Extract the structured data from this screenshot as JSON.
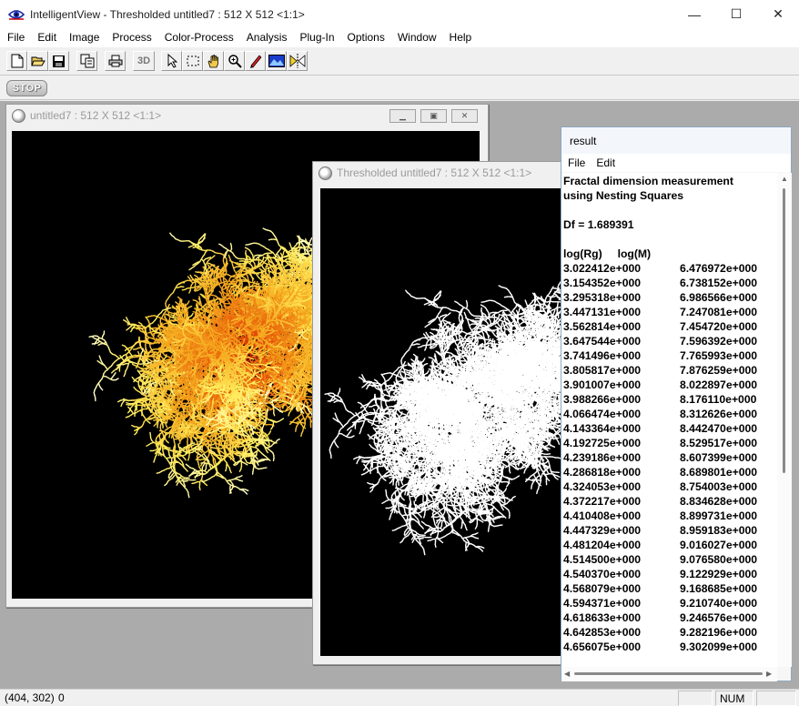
{
  "app": {
    "title": "IntelligentView - Thresholded untitled7 : 512 X 512  <1:1>"
  },
  "window_controls": {
    "minimize": "—",
    "maximize": "☐",
    "close": "✕"
  },
  "menu": [
    "File",
    "Edit",
    "Image",
    "Process",
    "Color-Process",
    "Analysis",
    "Plug-In",
    "Options",
    "Window",
    "Help"
  ],
  "toolbar": {
    "icons": [
      "new-file-icon",
      "open-folder-icon",
      "save-icon",
      "copy-icon",
      "print-icon",
      "3d-icon",
      "pointer-icon",
      "select-rect-icon",
      "hand-icon",
      "zoom-icon",
      "pen-icon",
      "image-icon",
      "flip-icon"
    ],
    "label_3d": "3D",
    "stop_label": "STOP"
  },
  "windows": {
    "original": {
      "title": "untitled7 : 512 X 512  <1:1>"
    },
    "thresholded": {
      "title": "Thresholded untitled7 : 512 X 512  <1:1>"
    }
  },
  "result": {
    "title": "result",
    "menu": [
      "File",
      "Edit"
    ],
    "heading_line1": "Fractal dimension measurement",
    "heading_line2": "using Nesting Squares",
    "df": "Df = 1.689391",
    "col_header": "log(Rg)     log(M)",
    "rows": [
      [
        "3.022412e+000",
        "6.476972e+000"
      ],
      [
        "3.154352e+000",
        "6.738152e+000"
      ],
      [
        "3.295318e+000",
        "6.986566e+000"
      ],
      [
        "3.447131e+000",
        "7.247081e+000"
      ],
      [
        "3.562814e+000",
        "7.454720e+000"
      ],
      [
        "3.647544e+000",
        "7.596392e+000"
      ],
      [
        "3.741496e+000",
        "7.765993e+000"
      ],
      [
        "3.805817e+000",
        "7.876259e+000"
      ],
      [
        "3.901007e+000",
        "8.022897e+000"
      ],
      [
        "3.988266e+000",
        "8.176110e+000"
      ],
      [
        "4.066474e+000",
        "8.312626e+000"
      ],
      [
        "4.143364e+000",
        "8.442470e+000"
      ],
      [
        "4.192725e+000",
        "8.529517e+000"
      ],
      [
        "4.239186e+000",
        "8.607399e+000"
      ],
      [
        "4.286818e+000",
        "8.689801e+000"
      ],
      [
        "4.324053e+000",
        "8.754003e+000"
      ],
      [
        "4.372217e+000",
        "8.834628e+000"
      ],
      [
        "4.410408e+000",
        "8.899731e+000"
      ],
      [
        "4.447329e+000",
        "8.959183e+000"
      ],
      [
        "4.481204e+000",
        "9.016027e+000"
      ],
      [
        "4.514500e+000",
        "9.076580e+000"
      ],
      [
        "4.540370e+000",
        "9.122929e+000"
      ],
      [
        "4.568079e+000",
        "9.168685e+000"
      ],
      [
        "4.594371e+000",
        "9.210740e+000"
      ],
      [
        "4.618633e+000",
        "9.246576e+000"
      ],
      [
        "4.642853e+000",
        "9.282196e+000"
      ],
      [
        "4.656075e+000",
        "9.302099e+000"
      ]
    ]
  },
  "status": {
    "coords": "(404, 302)",
    "value": "0",
    "num": "NUM"
  },
  "colors": {
    "workspace": "#ababab",
    "canvas": "#000000",
    "fractal_core": "#cc1a00",
    "fractal_tip": "#ffffb0",
    "threshold": "#ffffff"
  }
}
